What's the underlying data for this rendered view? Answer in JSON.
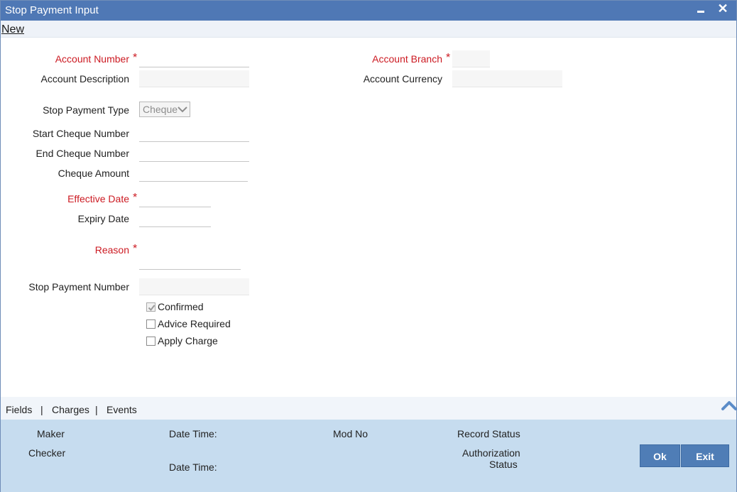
{
  "window": {
    "title": "Stop Payment Input",
    "minimize_icon": "minimize-icon",
    "close_glyph": "✕"
  },
  "menu": {
    "new_label": "New"
  },
  "form": {
    "account_number_label": "Account Number",
    "account_number_value": "",
    "account_branch_label": "Account Branch",
    "account_branch_value": "",
    "account_description_label": "Account Description",
    "account_description_value": "",
    "account_currency_label": "Account Currency",
    "account_currency_value": "",
    "stop_payment_type_label": "Stop Payment Type",
    "stop_payment_type_value": "Cheque",
    "start_cheque_number_label": "Start Cheque Number",
    "start_cheque_number_value": "",
    "end_cheque_number_label": "End Cheque Number",
    "end_cheque_number_value": "",
    "cheque_amount_label": "Cheque Amount",
    "cheque_amount_value": "",
    "effective_date_label": "Effective Date",
    "effective_date_value": "",
    "expiry_date_label": "Expiry Date",
    "expiry_date_value": "",
    "reason_label": "Reason",
    "reason_value": "",
    "stop_payment_number_label": "Stop Payment Number",
    "stop_payment_number_value": "",
    "required_marker": "*"
  },
  "checkboxes": [
    {
      "label": "Confirmed",
      "checked": true,
      "disabled": true
    },
    {
      "label": "Advice Required",
      "checked": false
    },
    {
      "label": "Apply Charge",
      "checked": false
    }
  ],
  "subtabs": {
    "fields": "Fields",
    "charges": "Charges",
    "events": "Events",
    "separator": "|"
  },
  "footer": {
    "maker": "Maker",
    "checker": "Checker",
    "date_time_1": "Date Time:",
    "date_time_2": "Date Time:",
    "mod_no": "Mod No",
    "record_status": "Record Status",
    "authorization_status_1": "Authorization",
    "authorization_status_2": "Status",
    "ok_button": "Ok",
    "exit_button": "Exit"
  },
  "colors": {
    "titlebar": "#4f78b5",
    "required": "#cc1a22",
    "footer": "#c6dcef",
    "button": "#4f7db6"
  }
}
